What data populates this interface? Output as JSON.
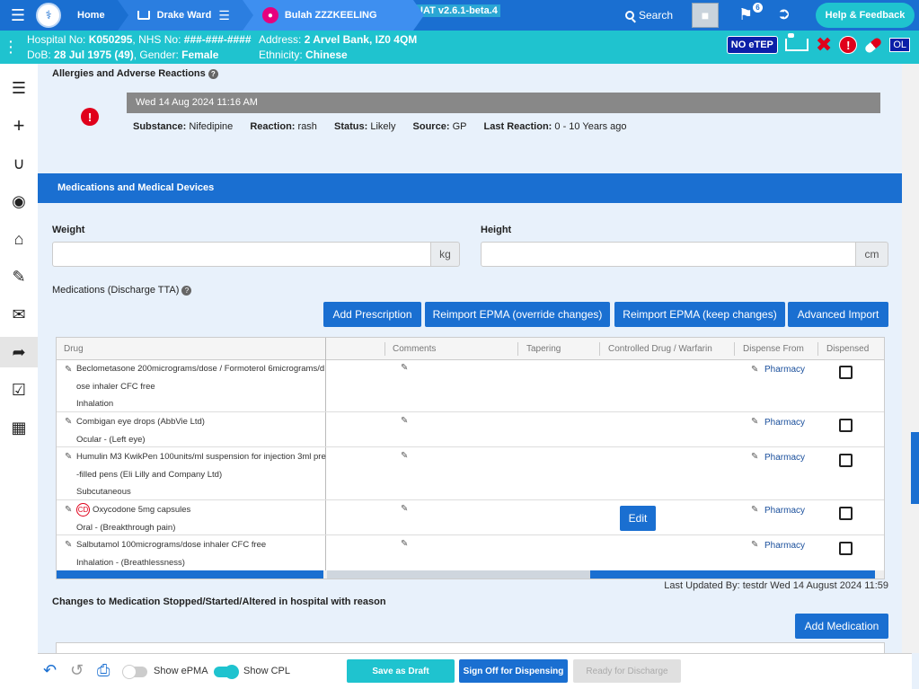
{
  "topbar": {
    "home_label": "Home",
    "ward_label": "Drake Ward",
    "patient_label": "Bulah ZZZKEELING",
    "env_badge": "UAT v2.6.1-beta.4",
    "search_label": "Search",
    "flag_count": "6",
    "help_label": "Help & Feedback"
  },
  "banner": {
    "hospital_label": "Hospital No: ",
    "hospital_value": "K050295",
    "nhs_label": ", NHS No: ",
    "nhs_value": "###-###-####",
    "address_label": "Address: ",
    "address_value": "2 Arvel Bank, IZ0 4QM",
    "dob_label": "DoB: ",
    "dob_value": "28 Jul 1975 (49)",
    "gender_label": ", Gender: ",
    "gender_value": "Female",
    "ethnicity_label": "Ethnicity: ",
    "ethnicity_value": "Chinese",
    "noetep": "NO eTEP",
    "ol": "OL"
  },
  "allergies": {
    "title": "Allergies and Adverse Reactions",
    "date": "Wed 14 Aug 2024 11:16 AM",
    "substance_label": "Substance:",
    "substance": "Nifedipine",
    "reaction_label": "Reaction:",
    "reaction": "rash",
    "status_label": "Status:",
    "status": "Likely",
    "source_label": "Source:",
    "source": "GP",
    "last_reaction_label": "Last Reaction:",
    "last_reaction": "0 - 10 Years ago"
  },
  "meds": {
    "header": "Medications and Medical Devices",
    "weight_label": "Weight",
    "weight_unit": "kg",
    "height_label": "Height",
    "height_unit": "cm",
    "discharge_label": "Medications (Discharge TTA)",
    "btn_add": "Add Prescription",
    "btn_reimport_override": "Reimport EPMA (override changes)",
    "btn_reimport_keep": "Reimport EPMA (keep changes)",
    "btn_advanced": "Advanced Import",
    "columns": [
      "Drug",
      "Comments",
      "Tapering",
      "Controlled Drug / Warfarin",
      "Dispense From",
      "Dispensed"
    ],
    "rows": [
      {
        "lines": [
          "Beclometasone 200micrograms/dose / Formoterol 6micrograms/d",
          "ose inhaler CFC free",
          "Inhalation"
        ],
        "dispense": "Pharmacy"
      },
      {
        "lines": [
          "Combigan eye drops (AbbVie Ltd)",
          "Ocular - (Left eye)"
        ],
        "dispense": "Pharmacy"
      },
      {
        "lines": [
          "Humulin M3 KwikPen 100units/ml suspension for injection 3ml pre",
          "-filled pens (Eli Lilly and Company Ltd)",
          "Subcutaneous"
        ],
        "dispense": "Pharmacy"
      },
      {
        "lines": [
          "Oxycodone 5mg capsules",
          "Oral - (Breakthrough pain)"
        ],
        "dispense": "Pharmacy",
        "cd": "CD",
        "edit": "Edit"
      },
      {
        "lines": [
          "Salbutamol 100micrograms/dose inhaler CFC free",
          "Inhalation - (Breathlessness)"
        ],
        "dispense": "Pharmacy"
      }
    ],
    "last_updated": "Last Updated By: testdr Wed 14 August 2024 11:59",
    "changes_label": "Changes to Medication Stopped/Started/Altered in hospital with reason",
    "btn_add_medication": "Add Medication"
  },
  "footer": {
    "show_epma": "Show ePMA",
    "show_cpl": "Show CPL",
    "save_draft": "Save as Draft",
    "sign_off": "Sign Off for Dispensing",
    "ready": "Ready for Discharge"
  },
  "colors": {
    "primary": "#1a6fd1",
    "teal": "#1fc3cf",
    "alert": "#e0001b",
    "navy": "#0b1fa8"
  }
}
